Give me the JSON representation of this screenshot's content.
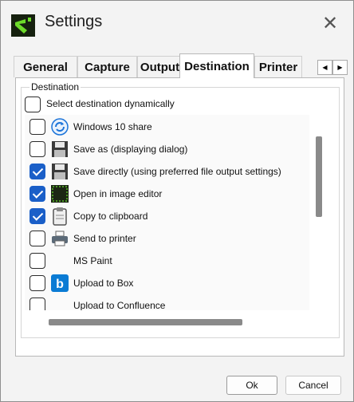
{
  "window": {
    "title": "Settings"
  },
  "tabs": [
    {
      "label": "General"
    },
    {
      "label": "Capture"
    },
    {
      "label": "Output"
    },
    {
      "label": "Destination"
    },
    {
      "label": "Printer"
    }
  ],
  "active_tab": "Destination",
  "tab_scroll": {
    "left": "◀",
    "right": "▶"
  },
  "destination": {
    "group_label": "Destination",
    "dynamic": {
      "label": "Select destination dynamically",
      "checked": false
    },
    "items": [
      {
        "label": "Windows 10 share",
        "checked": false,
        "icon": "share-icon"
      },
      {
        "label": "Save as (displaying dialog)",
        "checked": false,
        "icon": "floppy-icon"
      },
      {
        "label": "Save directly (using preferred file output settings)",
        "checked": true,
        "icon": "floppy-icon"
      },
      {
        "label": "Open in image editor",
        "checked": true,
        "icon": "image-editor-icon"
      },
      {
        "label": "Copy to clipboard",
        "checked": true,
        "icon": "clipboard-icon"
      },
      {
        "label": "Send to printer",
        "checked": false,
        "icon": "printer-icon"
      },
      {
        "label": "MS Paint",
        "checked": false,
        "icon": ""
      },
      {
        "label": "Upload to Box",
        "checked": false,
        "icon": "box-icon"
      },
      {
        "label": "Upload to Confluence",
        "checked": false,
        "icon": ""
      }
    ]
  },
  "buttons": {
    "ok": "Ok",
    "cancel": "Cancel"
  },
  "colors": {
    "accent": "#1a5fc8",
    "window_bg": "#f3f3f3",
    "panel_bg": "#ffffff"
  }
}
